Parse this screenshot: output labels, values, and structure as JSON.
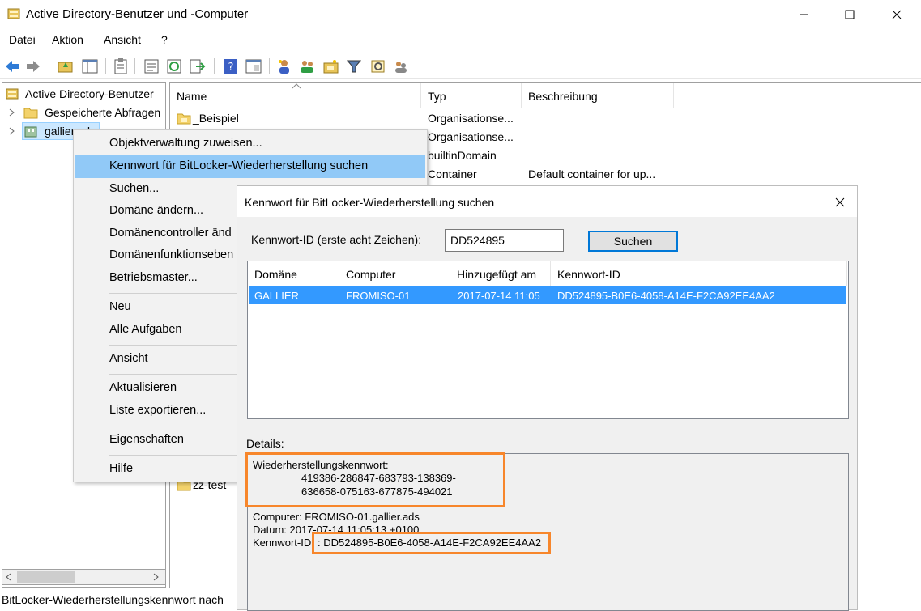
{
  "window": {
    "title": "Active Directory-Benutzer und -Computer",
    "minimize": "minimize",
    "maximize": "maximize",
    "close": "close"
  },
  "menu": {
    "file": "Datei",
    "action": "Aktion",
    "view": "Ansicht",
    "help": "?"
  },
  "tree": {
    "root": "Active Directory-Benutzer",
    "saved_queries": "Gespeicherte Abfragen",
    "domain": "gallier.ads"
  },
  "list": {
    "columns": [
      "Name",
      "Typ",
      "Beschreibung"
    ],
    "rows": [
      {
        "name": "_Beispiel",
        "type": "Organisationse...",
        "desc": ""
      },
      {
        "name": "",
        "type": "Organisationse...",
        "desc": ""
      },
      {
        "name": "",
        "type": "builtinDomain",
        "desc": ""
      },
      {
        "name": "",
        "type": "Container",
        "desc": "Default container for up..."
      }
    ],
    "partial_item": "zz-test"
  },
  "context_menu": {
    "items": [
      "Objektverwaltung zuweisen...",
      "Kennwort für BitLocker-Wiederherstellung suchen",
      "Suchen...",
      "Domäne ändern...",
      "Domänencontroller änd",
      "Domänenfunktionseben",
      "Betriebsmaster...",
      "Neu",
      "Alle Aufgaben",
      "Ansicht",
      "Aktualisieren",
      "Liste exportieren...",
      "Eigenschaften",
      "Hilfe"
    ]
  },
  "dialog": {
    "title": "Kennwort für BitLocker-Wiederherstellung suchen",
    "id_label": "Kennwort-ID (erste acht Zeichen):",
    "id_value": "DD524895",
    "search_button": "Suchen",
    "columns": [
      "Domäne",
      "Computer",
      "Hinzugefügt am",
      "Kennwort-ID"
    ],
    "result": {
      "domain": "GALLIER",
      "computer": "FROMISO-01",
      "added": "2017-07-14 11:05",
      "key_id": "DD524895-B0E6-4058-A14E-F2CA92EE4AA2"
    },
    "details_label": "Details:",
    "details": {
      "recovery_label": "Wiederherstellungskennwort:",
      "recovery_line1": "419386-286847-683793-138369-",
      "recovery_line2": "636658-075163-677875-494021",
      "computer_line": "Computer: FROMISO-01.gallier.ads",
      "date_line": "Datum: 2017-07-14 11:05:13 +0100",
      "keyid_prefix": "Kennwort-ID",
      "keyid_value": ": DD524895-B0E6-4058-A14E-F2CA92EE4AA2"
    },
    "highlight_color": "#f7862b"
  },
  "status": {
    "text": "BitLocker-Wiederherstellungskennwort nach"
  }
}
